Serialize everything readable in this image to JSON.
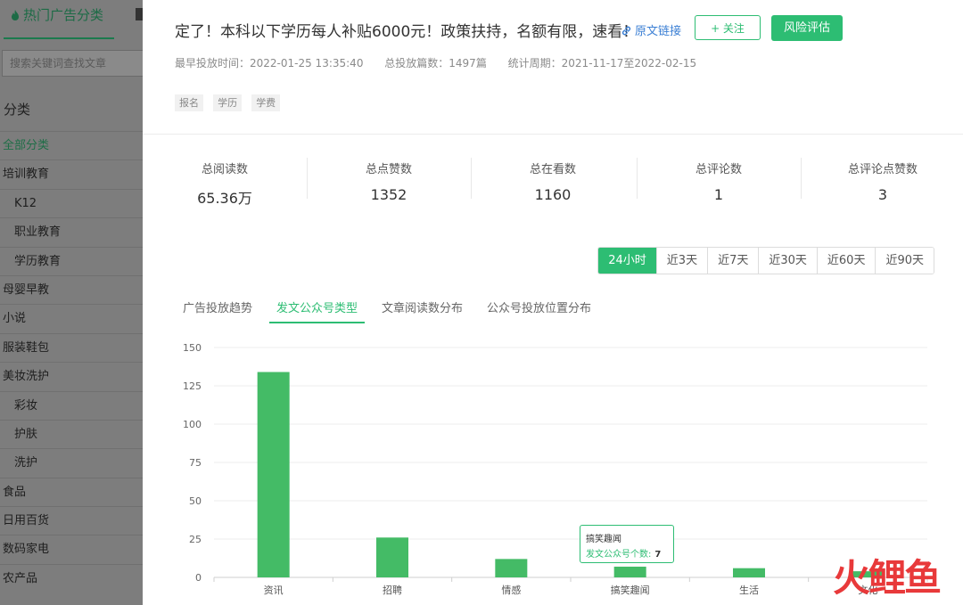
{
  "sidebar": {
    "active_tab": "热门广告分类",
    "search_placeholder": "搜索关键词查找文章",
    "category_title": "分类",
    "items": [
      {
        "label": "全部分类",
        "sub": false,
        "active": true
      },
      {
        "label": "培训教育",
        "sub": false
      },
      {
        "label": "K12",
        "sub": true
      },
      {
        "label": "职业教育",
        "sub": true
      },
      {
        "label": "学历教育",
        "sub": true
      },
      {
        "label": "母婴早教",
        "sub": false
      },
      {
        "label": "小说",
        "sub": false
      },
      {
        "label": "服装鞋包",
        "sub": false
      },
      {
        "label": "美妆洗护",
        "sub": false
      },
      {
        "label": "彩妆",
        "sub": true
      },
      {
        "label": "护肤",
        "sub": true
      },
      {
        "label": "洗护",
        "sub": true
      },
      {
        "label": "食品",
        "sub": false
      },
      {
        "label": "日用百货",
        "sub": false
      },
      {
        "label": "数码家电",
        "sub": false
      },
      {
        "label": "农产品",
        "sub": false
      }
    ]
  },
  "header": {
    "title": "定了！本科以下学历每人补贴6000元！政策扶持，名额有限，速看！",
    "original_link": "原文链接",
    "follow_button": "+ 关注",
    "risk_button": "风险评估",
    "meta": {
      "first_time": "最早投放时间：2022-01-25 13:35:40",
      "total_articles": "总投放篇数：1497篇",
      "period": "统计周期：2021-11-17至2022-02-15"
    },
    "tags": [
      "报名",
      "学历",
      "学费"
    ]
  },
  "stats": [
    {
      "label": "总阅读数",
      "value": "65.36万"
    },
    {
      "label": "总点赞数",
      "value": "1352"
    },
    {
      "label": "总在看数",
      "value": "1160"
    },
    {
      "label": "总评论数",
      "value": "1"
    },
    {
      "label": "总评论点赞数",
      "value": "3"
    }
  ],
  "ranges": [
    "24小时",
    "近3天",
    "近7天",
    "近30天",
    "近60天",
    "近90天"
  ],
  "active_range": 0,
  "tabs": [
    "广告投放趋势",
    "发文公众号类型",
    "文章阅读数分布",
    "公众号投放位置分布"
  ],
  "active_tab": 1,
  "tooltip": {
    "category": "搞笑趣闻",
    "series_label": "发文公众号个数:",
    "value": "7"
  },
  "colors": {
    "accent": "#2dbd73",
    "bar": "#44bb66",
    "link": "#3b7fd4"
  },
  "watermark": "火鲤鱼",
  "chart_data": {
    "type": "bar",
    "categories": [
      "资讯",
      "招聘",
      "情感",
      "搞笑趣闻",
      "生活",
      "文化"
    ],
    "values": [
      134,
      26,
      12,
      7,
      6,
      4
    ],
    "ylim": [
      0,
      150
    ],
    "yticks": [
      "0",
      "25",
      "50",
      "75",
      "100",
      "125",
      "150"
    ],
    "grid": true
  }
}
